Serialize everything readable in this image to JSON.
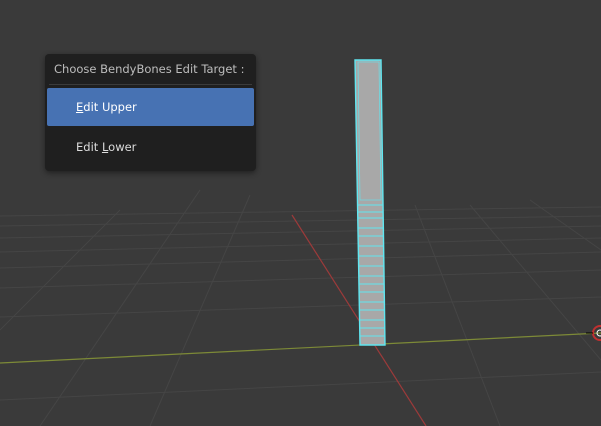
{
  "popup_menu": {
    "title": "Choose BendyBones Edit Target :",
    "items": [
      {
        "pre": "",
        "key": "E",
        "post": "dit Upper",
        "active": true
      },
      {
        "pre": "Edit ",
        "key": "L",
        "post": "ower",
        "active": false
      }
    ]
  },
  "viewport": {
    "background_color": "#3a3a3a",
    "grid_color": "#454545",
    "x_axis_color": "#9c3a3a",
    "y_axis_color": "#7d8a37",
    "bone_fill_color": "#a8a8a8",
    "bone_outline_color": "#5fe6f0"
  }
}
